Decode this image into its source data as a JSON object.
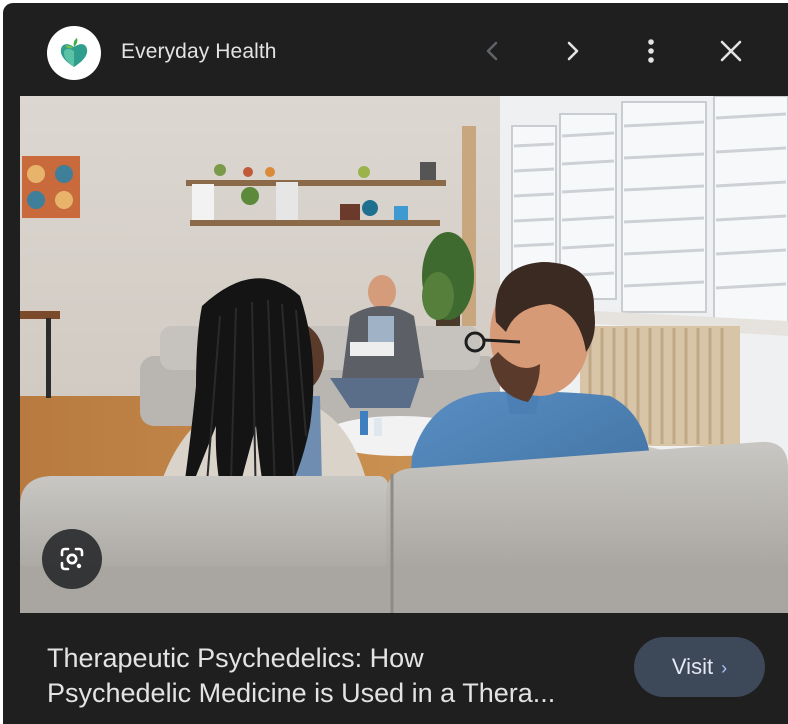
{
  "header": {
    "source_name": "Everyday Health",
    "logo_icon": "apple-heart-logo",
    "prev_icon": "chevron-left-icon",
    "next_icon": "chevron-right-icon",
    "more_icon": "more-vert-icon",
    "close_icon": "close-icon"
  },
  "image": {
    "lens_icon": "google-lens-icon"
  },
  "article": {
    "title_line1": "Therapeutic Psychedelics: How",
    "title_line2": "Psychedelic Medicine is Used in a Thera..."
  },
  "visit_button": {
    "label": "Visit",
    "chevron": "›"
  },
  "colors": {
    "panel_bg": "#1f1f1f",
    "text": "#e3e3e3",
    "visit_bg": "#3d4859",
    "accent": "#a8c7fa"
  }
}
